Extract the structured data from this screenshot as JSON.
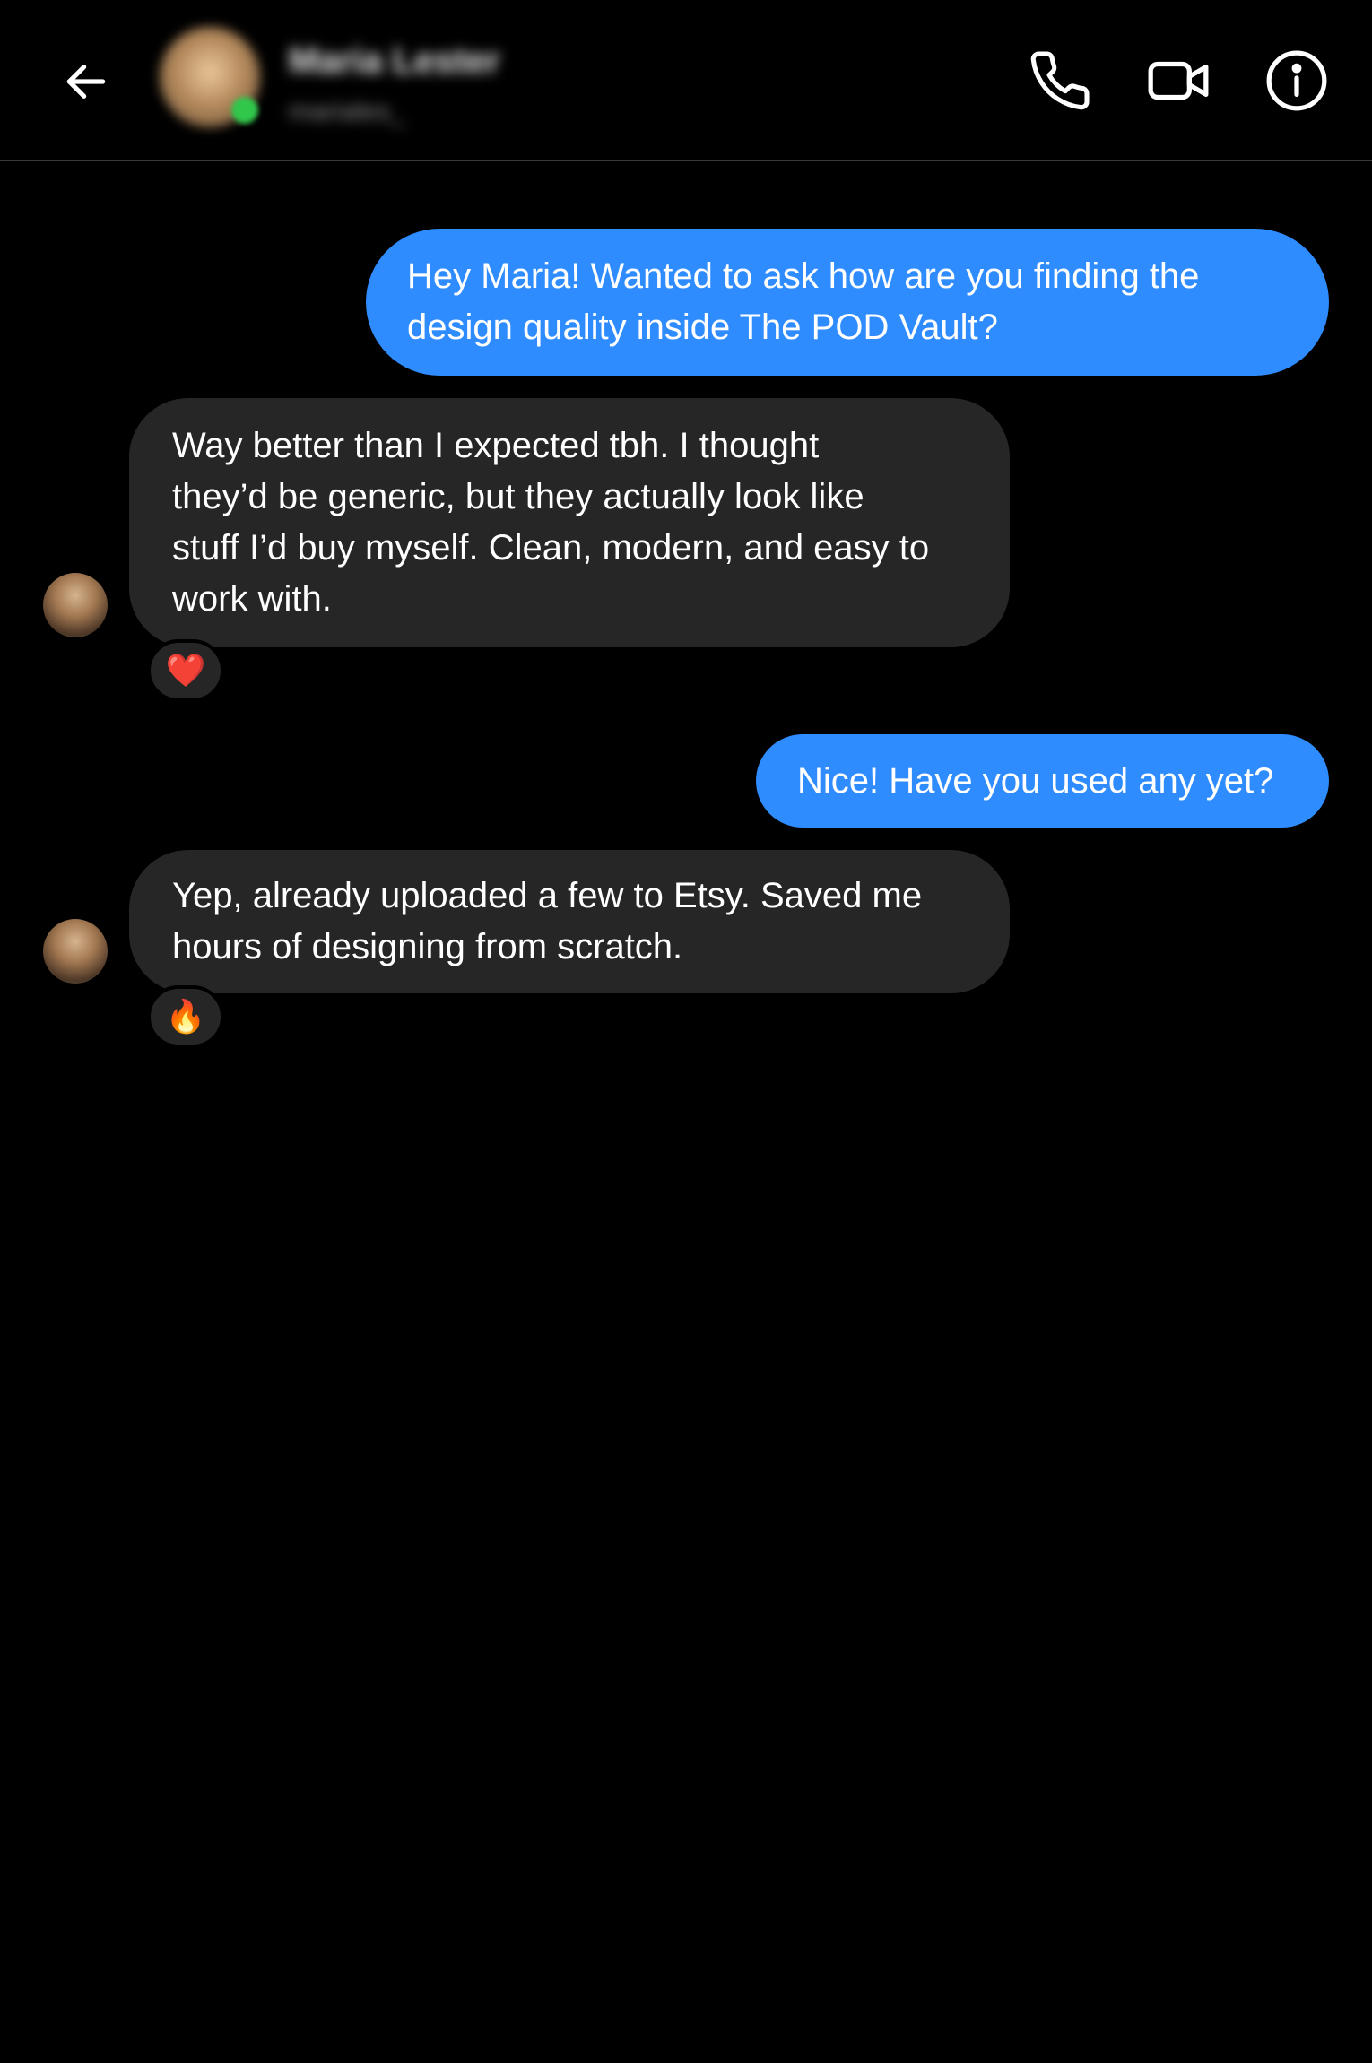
{
  "header": {
    "contact_name": "Maria Lester",
    "contact_handle": "mariales_"
  },
  "colors": {
    "outgoing_bubble": "#2f8cff",
    "incoming_bubble": "#262626",
    "background": "#000000",
    "online_status": "#31c74b"
  },
  "icons": {
    "back": "arrow-left-icon",
    "call": "phone-icon",
    "video": "video-camera-icon",
    "info": "info-icon"
  },
  "messages": [
    {
      "direction": "outgoing",
      "text": "Hey Maria! Wanted to ask how are you finding the\ndesign quality inside The POD Vault?"
    },
    {
      "direction": "incoming",
      "text": "Way better than I expected tbh. I thought\nthey’d be generic, but they actually look like\nstuff I’d buy myself. Clean, modern, and easy to\nwork with.",
      "reaction": "❤️"
    },
    {
      "direction": "outgoing",
      "text": "Nice! Have you used any yet?"
    },
    {
      "direction": "incoming",
      "text": "Yep, already uploaded a few to Etsy. Saved me\nhours of designing from scratch.",
      "reaction": "🔥"
    }
  ]
}
